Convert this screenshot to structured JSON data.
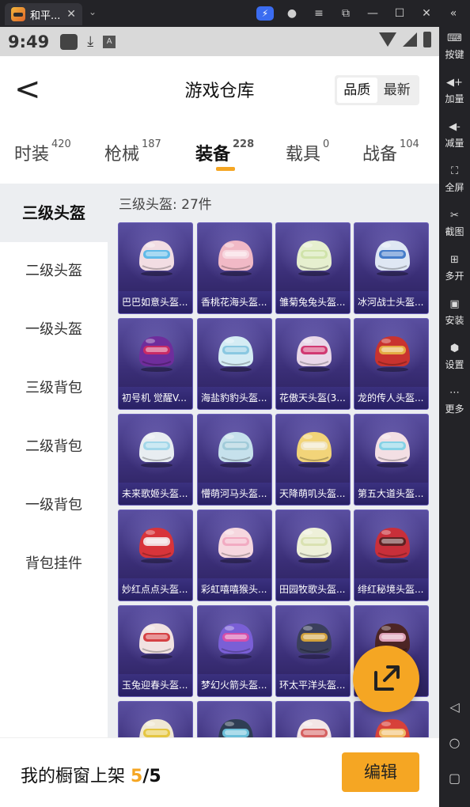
{
  "window": {
    "tab_title": "和平...",
    "close_glyph": "✕",
    "dropdown_glyph": "⌄",
    "controls": [
      "⚡",
      "●",
      "≡",
      "⧉",
      "—",
      "☐",
      "✕",
      "«"
    ]
  },
  "status_bar": {
    "time": "9:49",
    "a_glyph": "A",
    "download_glyph": "⤓"
  },
  "header": {
    "title": "游戏仓库",
    "back_glyph": "<",
    "sort_options": [
      "品质",
      "最新"
    ],
    "active_sort": "品质"
  },
  "categories": [
    {
      "label": "时装",
      "count": "420"
    },
    {
      "label": "枪械",
      "count": "187"
    },
    {
      "label": "装备",
      "count": "228",
      "active": true
    },
    {
      "label": "载具",
      "count": "0"
    },
    {
      "label": "战备",
      "count": "104"
    }
  ],
  "sidebar": [
    {
      "label": "三级头盔",
      "active": true
    },
    {
      "label": "二级头盔"
    },
    {
      "label": "一级头盔"
    },
    {
      "label": "三级背包"
    },
    {
      "label": "二级背包"
    },
    {
      "label": "一级背包"
    },
    {
      "label": "背包挂件"
    }
  ],
  "grid": {
    "title": "三级头盔: 27件",
    "items": [
      {
        "name": "巴巴如意头盔...",
        "color": "#f2dde3",
        "accent": "#58b7e8"
      },
      {
        "name": "香桃花海头盔...",
        "color": "#f1b9c6",
        "accent": "#f7d8e0"
      },
      {
        "name": "雏菊兔兔头盔...",
        "color": "#e6efcf",
        "accent": "#cfe1a8"
      },
      {
        "name": "冰河战士头盔...",
        "color": "#dfe7f3",
        "accent": "#3d77c7"
      },
      {
        "name": "初号机 觉醒V...",
        "color": "#6f2d9c",
        "accent": "#cc2b63"
      },
      {
        "name": "海盐豹豹头盔...",
        "color": "#d4ecf4",
        "accent": "#86c6df"
      },
      {
        "name": "花傲天头盔(3...",
        "color": "#e9d7e8",
        "accent": "#d0306b"
      },
      {
        "name": "龙的传人头盔...",
        "color": "#c9332f",
        "accent": "#e6b245"
      },
      {
        "name": "未来歌姬头盔...",
        "color": "#e8edf1",
        "accent": "#9fd6e8"
      },
      {
        "name": "懵萌河马头盔...",
        "color": "#c6e1ec",
        "accent": "#9fc9d8"
      },
      {
        "name": "天降萌叽头盔...",
        "color": "#f2d479",
        "accent": "#f0e6c5"
      },
      {
        "name": "第五大道头盔...",
        "color": "#f3dfe4",
        "accent": "#7fd1e6"
      },
      {
        "name": "妙红点点头盔...",
        "color": "#d8343a",
        "accent": "#f1e3e3"
      },
      {
        "name": "彩虹嘻嘻猴头...",
        "color": "#f6d7df",
        "accent": "#f1a9c0"
      },
      {
        "name": "田园牧歌头盔...",
        "color": "#eef0d9",
        "accent": "#d8e0b0"
      },
      {
        "name": "绯红秘境头盔...",
        "color": "#c92f3a",
        "accent": "#5a2222"
      },
      {
        "name": "玉兔迎春头盔...",
        "color": "#f1e2e1",
        "accent": "#d3383b"
      },
      {
        "name": "梦幻火箭头盔...",
        "color": "#7a5fd6",
        "accent": "#d94ea8"
      },
      {
        "name": "环太平洋头盔...",
        "color": "#3b3f5c",
        "accent": "#d8a53a"
      },
      {
        "name": "",
        "color": "#4d2525",
        "accent": "#e6a8c0"
      },
      {
        "name": "",
        "color": "#f0e8d4",
        "accent": "#e4c43a"
      },
      {
        "name": "",
        "color": "#2f3e54",
        "accent": "#6fc6e0"
      },
      {
        "name": "",
        "color": "#f3e6e6",
        "accent": "#d35a5a"
      },
      {
        "name": "",
        "color": "#d7413a",
        "accent": "#f1c36a"
      }
    ]
  },
  "bottom_bar": {
    "label": "我的橱窗上架",
    "count": "5",
    "total": "/5",
    "edit_label": "编辑"
  },
  "emulator_sidebar": [
    {
      "label": "按键",
      "icon": "keyboard-icon",
      "glyph": "⌨"
    },
    {
      "label": "加量",
      "icon": "volume-up-icon",
      "glyph": "◀+"
    },
    {
      "label": "减量",
      "icon": "volume-down-icon",
      "glyph": "◀-"
    },
    {
      "label": "全屏",
      "icon": "fullscreen-icon",
      "glyph": "⛶"
    },
    {
      "label": "截图",
      "icon": "scissors-icon",
      "glyph": "✂"
    },
    {
      "label": "多开",
      "icon": "multi-instance-icon",
      "glyph": "⊞"
    },
    {
      "label": "安装",
      "icon": "apk-install-icon",
      "glyph": "▣"
    },
    {
      "label": "设置",
      "icon": "gear-icon",
      "glyph": "⬢"
    },
    {
      "label": "更多",
      "icon": "more-icon",
      "glyph": "⋯"
    }
  ],
  "nav_buttons": [
    {
      "glyph": "◁",
      "icon": "back-nav-icon"
    },
    {
      "glyph": "○",
      "icon": "home-nav-icon"
    },
    {
      "glyph": "▢",
      "icon": "recents-nav-icon"
    }
  ]
}
